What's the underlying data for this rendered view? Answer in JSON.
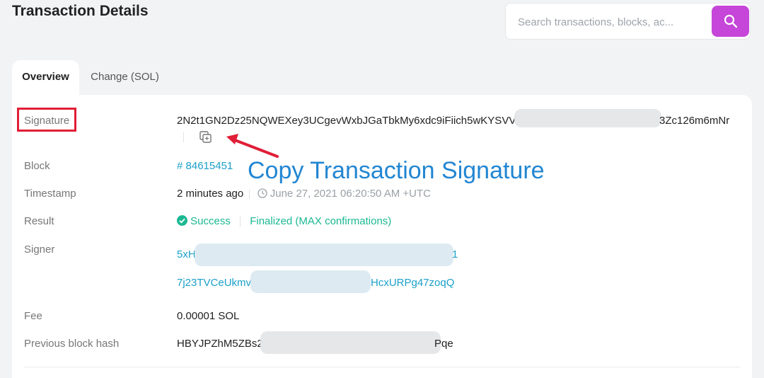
{
  "page": {
    "title": "Transaction Details"
  },
  "search": {
    "placeholder": "Search transactions, blocks, ac..."
  },
  "tabs": [
    {
      "label": "Overview",
      "active": true
    },
    {
      "label": "Change (SOL)",
      "active": false
    }
  ],
  "rows": {
    "signature": {
      "label": "Signature",
      "value_start": "2N2t1GN2Dz25NQWEXey3UCgevWxbJGaTbkMy6xdc9iFiich5wKYSVV",
      "value_end": "3Zc126m6mNr"
    },
    "block": {
      "label": "Block",
      "value": "# 84615451"
    },
    "timestamp": {
      "label": "Timestamp",
      "relative": "2 minutes ago",
      "absolute": "June 27, 2021 06:20:50 AM +UTC"
    },
    "result": {
      "label": "Result",
      "status": "Success",
      "finality": "Finalized (MAX confirmations)"
    },
    "signer": {
      "label": "Signer",
      "values": [
        {
          "start": "5xH",
          "end": "1"
        },
        {
          "start": "7j23TVCeUkmv",
          "end": "HcxURPg47zoqQ"
        }
      ]
    },
    "fee": {
      "label": "Fee",
      "value": "0.00001 SOL"
    },
    "previous_block_hash": {
      "label": "Previous block hash",
      "value_start": "HBYJPZhM5ZBs2",
      "value_end": "Pqe"
    }
  },
  "annotation": {
    "text": "Copy Transaction Signature"
  },
  "colors": {
    "accent": "#c546d8",
    "link": "#1ba0c8",
    "success": "#1cb893",
    "annotation": "#2286d2",
    "highlight": "#e01e37"
  },
  "icons": [
    "search-icon",
    "copy-icon",
    "clock-icon",
    "check-circle-icon",
    "arrow-icon"
  ]
}
